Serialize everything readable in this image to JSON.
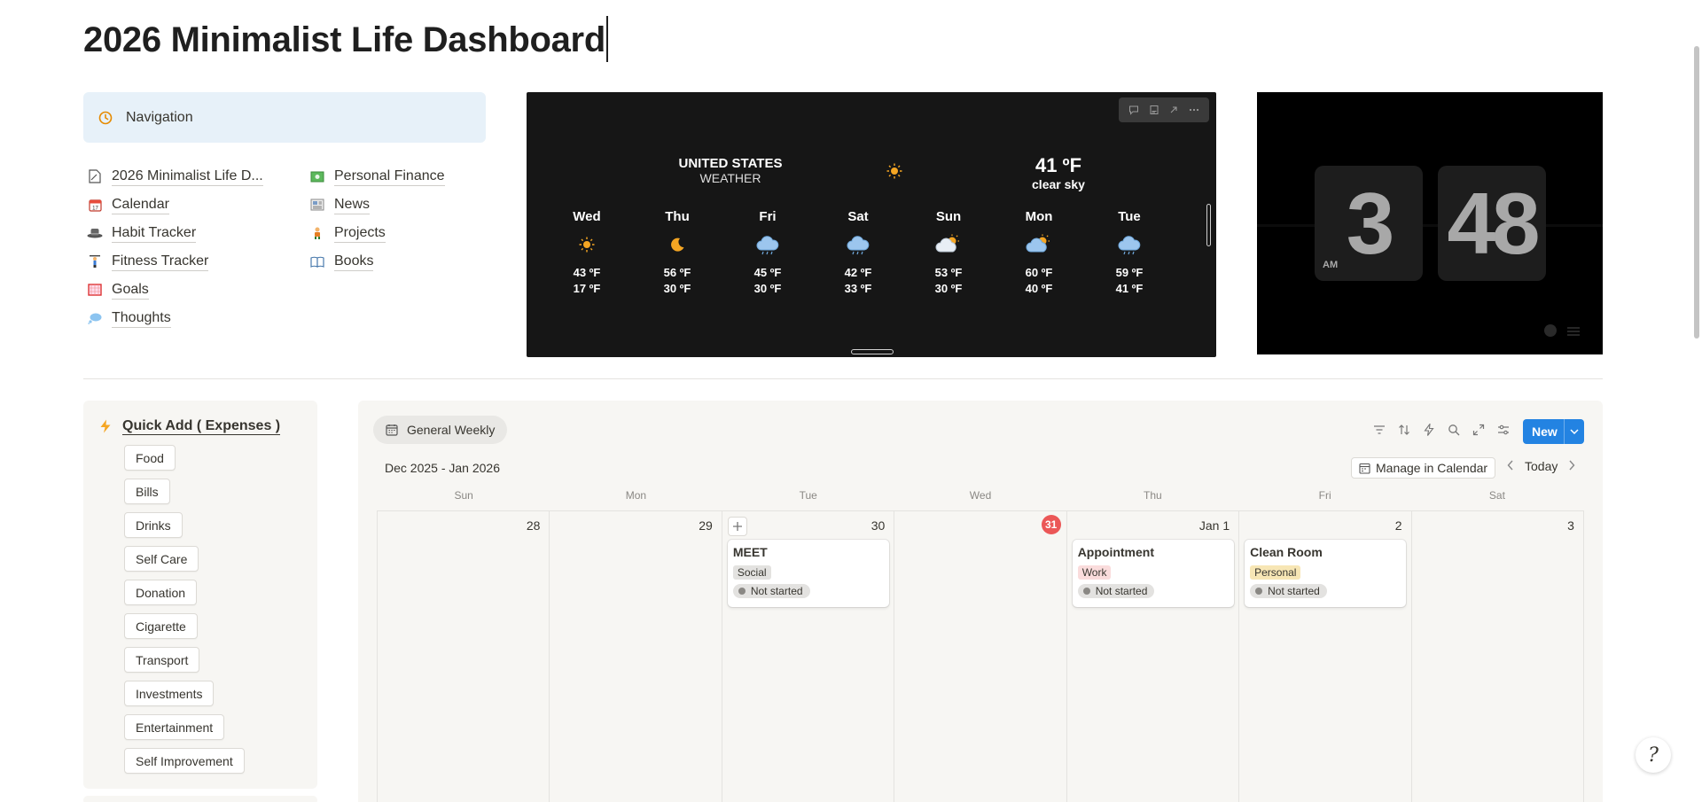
{
  "page": {
    "title": "2026 Minimalist Life Dashboard"
  },
  "navigation": {
    "callout_label": "Navigation",
    "left_links": [
      {
        "label": "2026 Minimalist Life D...",
        "icon": "page-icon"
      },
      {
        "label": "Calendar",
        "icon": "calendar-icon"
      },
      {
        "label": "Habit Tracker",
        "icon": "hat-icon"
      },
      {
        "label": "Fitness Tracker",
        "icon": "person-lifting-icon"
      },
      {
        "label": "Goals",
        "icon": "goal-net-icon"
      },
      {
        "label": "Thoughts",
        "icon": "thought-bubble-icon"
      }
    ],
    "right_links": [
      {
        "label": "Personal Finance",
        "icon": "money-icon"
      },
      {
        "label": "News",
        "icon": "newspaper-icon"
      },
      {
        "label": "Projects",
        "icon": "person-icon"
      },
      {
        "label": "Books",
        "icon": "book-icon"
      }
    ]
  },
  "weather": {
    "location": "UNITED STATES",
    "subtitle": "WEATHER",
    "current_temp": "41 ºF",
    "current_condition": "clear sky",
    "days": [
      {
        "day": "Wed",
        "icon": "sun-icon",
        "hi": "43 ºF",
        "lo": "17 ºF"
      },
      {
        "day": "Thu",
        "icon": "moon-icon",
        "hi": "56 ºF",
        "lo": "30 ºF"
      },
      {
        "day": "Fri",
        "icon": "cloud-rain-icon",
        "hi": "45 ºF",
        "lo": "30 ºF"
      },
      {
        "day": "Sat",
        "icon": "cloud-rain-icon",
        "hi": "42 ºF",
        "lo": "33 ºF"
      },
      {
        "day": "Sun",
        "icon": "partly-cloudy-icon",
        "hi": "53 ºF",
        "lo": "30 ºF"
      },
      {
        "day": "Mon",
        "icon": "partly-cloudy-icon",
        "hi": "60 ºF",
        "lo": "40 ºF"
      },
      {
        "day": "Tue",
        "icon": "cloud-rain-icon",
        "hi": "59 ºF",
        "lo": "41 ºF"
      }
    ]
  },
  "clock": {
    "hour": "3",
    "minute": "48",
    "ampm": "AM"
  },
  "quick_add": {
    "title": "Quick Add ( Expenses )",
    "buttons": [
      "Food",
      "Bills",
      "Drinks",
      "Self Care",
      "Donation",
      "Cigarette",
      "Transport",
      "Investments",
      "Entertainment",
      "Self Improvement"
    ]
  },
  "calendar": {
    "view_label": "General Weekly",
    "new_label": "New",
    "range": "Dec 2025 - Jan 2026",
    "manage_label": "Manage in Calendar",
    "today_label": "Today",
    "weekdays": [
      "Sun",
      "Mon",
      "Tue",
      "Wed",
      "Thu",
      "Fri",
      "Sat"
    ],
    "dates": [
      "28",
      "29",
      "30",
      "31",
      "Jan 1",
      "2",
      "3"
    ],
    "events": [
      {
        "title": "MEET",
        "tag": "Social",
        "status": "Not started"
      },
      {
        "title": "Appointment",
        "tag": "Work",
        "status": "Not started"
      },
      {
        "title": "Clean Room",
        "tag": "Personal",
        "status": "Not started"
      }
    ]
  },
  "colors": {
    "accent": "#2383e2",
    "today_badge": "#eb5757",
    "tag_social": "#e3e2e0",
    "tag_work": "#fadcdc",
    "tag_personal": "#f7e6b5"
  }
}
